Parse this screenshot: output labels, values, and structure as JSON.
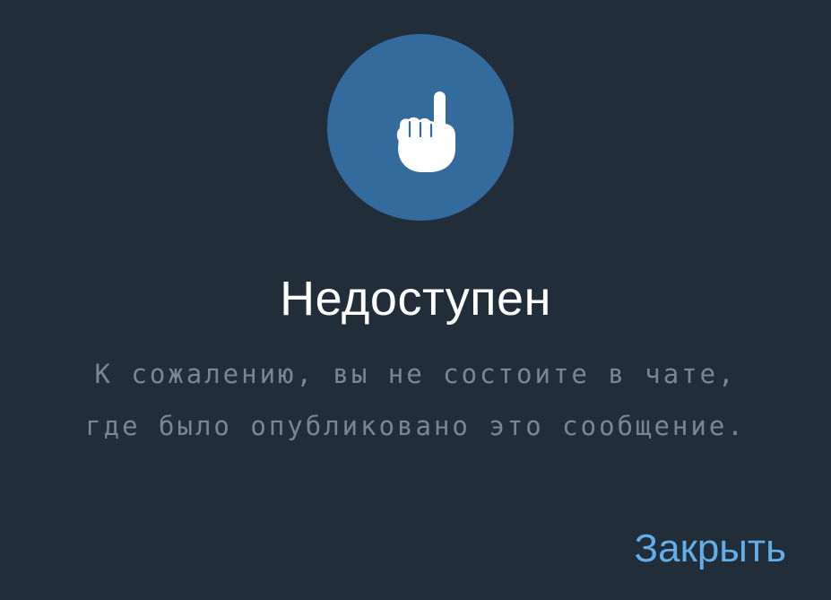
{
  "dialog": {
    "icon": "pointing-hand-icon",
    "title": "Недоступен",
    "message_lines": [
      "К сожалению, вы не состоите в чате,",
      "где было опубликовано это сообщение."
    ],
    "close_label": "Закрыть"
  },
  "colors": {
    "background": "#222d3a",
    "icon_circle": "#326b9c",
    "title": "#ffffff",
    "message": "#7c8692",
    "accent": "#62aee8"
  }
}
